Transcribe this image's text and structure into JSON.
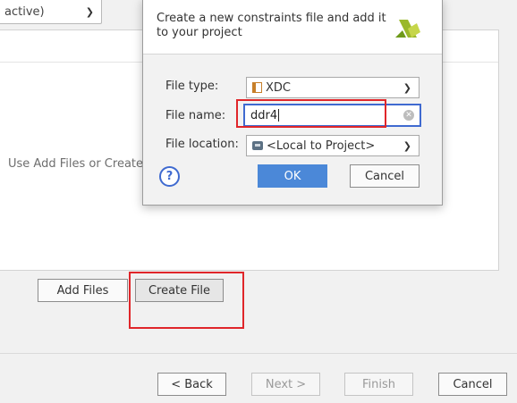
{
  "background": {
    "top_select_text": "active)",
    "hint_text": "Use Add Files or Create",
    "add_files_label": "Add Files",
    "create_file_label": "Create File"
  },
  "footer": {
    "back_label": "< Back",
    "next_label": "Next >",
    "finish_label": "Finish",
    "cancel_label": "Cancel"
  },
  "dialog": {
    "description": "Create a new constraints file and add it to your project",
    "file_type_label": "File type:",
    "file_type_value": "XDC",
    "file_name_label": "File name:",
    "file_name_value": "ddr4",
    "file_location_label": "File location:",
    "file_location_value": "<Local to Project>",
    "help_label": "?",
    "ok_label": "OK",
    "cancel_label": "Cancel"
  },
  "colors": {
    "highlight": "#e0262a",
    "focus_border": "#3f6ad0",
    "primary_button": "#4b88d8"
  }
}
